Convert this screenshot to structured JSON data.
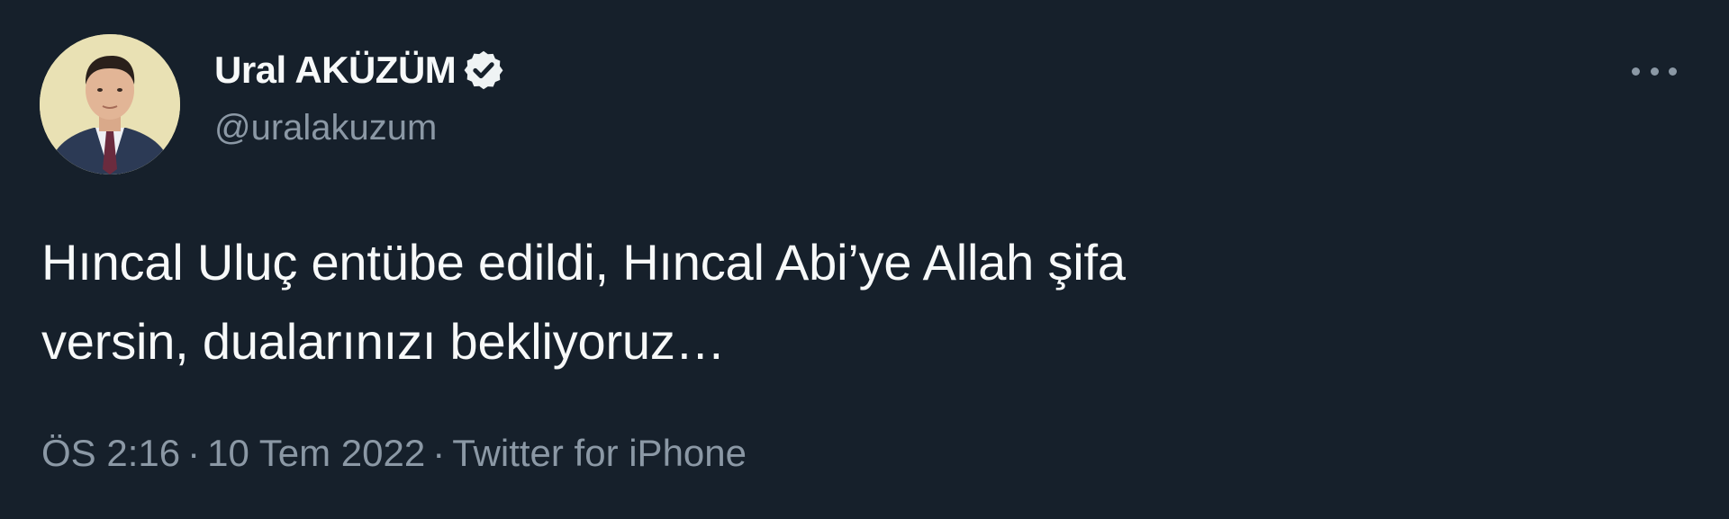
{
  "author": {
    "display_name": "Ural AKÜZÜM",
    "handle": "@uralakuzum",
    "verified_icon": "verified-badge-icon"
  },
  "tweet": {
    "text_line1": "Hıncal Uluç entübe edildi, Hıncal Abi’ye Allah şifa",
    "text_line2": "versin, dualarınızı bekliyoruz…"
  },
  "meta": {
    "time": "ÖS 2:16",
    "separator": "·",
    "date": "10 Tem 2022",
    "source": "Twitter for iPhone"
  },
  "more_icon": "more-options-icon",
  "colors": {
    "background": "#16202b",
    "text": "#f7f9f9",
    "muted": "#8b98a5"
  }
}
